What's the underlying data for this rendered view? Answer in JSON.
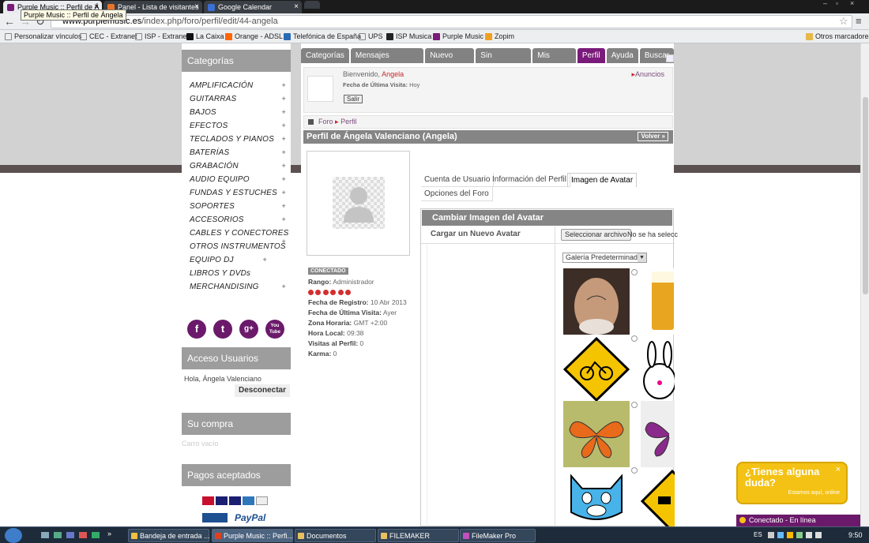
{
  "browser": {
    "tabs": [
      {
        "label": "Purple Music :: Perfil de Á",
        "color": "#7a1a7a"
      },
      {
        "label": "Panel - Lista de visitantes",
        "color": "#e8742a"
      },
      {
        "label": "Google Calendar",
        "color": "#3b6fd6"
      }
    ],
    "tooltip": "Purple Music :: Perfil de Ángela",
    "url_host": "www.purplemusic.es",
    "url_path": "/index.php/foro/perfil/edit/44-angela",
    "bookmarks": [
      "Personalizar vínculos",
      "CEC - Extranet",
      "ISP - Extranet",
      "La Caixa",
      "Orange - ADSL",
      "Telefónica de España",
      "UPS",
      "ISP Musica",
      "Purple Music",
      "Zopim"
    ],
    "other_bookmarks": "Otros marcadores"
  },
  "sidebar": {
    "categories_title": "Categorías",
    "categories": [
      "AMPLIFICACIÓN",
      "GUITARRAS",
      "BAJOS",
      "EFECTOS",
      "TECLADOS Y PIANOS",
      "BATERÍAS",
      "GRABACIÓN",
      "AUDIO EQUIPO",
      "FUNDAS Y ESTUCHES",
      "SOPORTES",
      "ACCESORIOS",
      "CABLES Y CONECTORES",
      "OTROS INSTRUMENTOS",
      "EQUIPO DJ",
      "LIBROS Y DVDs",
      "MERCHANDISING"
    ],
    "social": [
      "f",
      "t",
      "g+",
      "You Tube"
    ],
    "access_title": "Acceso Usuarios",
    "greeting": "Hola, Ángela Valenciano",
    "logout": "Desconectar",
    "cart_title": "Su compra",
    "cart_empty": "Carro vacío",
    "payments_title": "Pagos aceptados",
    "paypal": "PayPal"
  },
  "forum": {
    "menu": [
      "Categorías",
      "Mensajes Recientes",
      "Nuevo Tema",
      "Sin Respuesta",
      "Mis Temas",
      "Perfil",
      "Ayuda",
      "Buscar"
    ],
    "welcome": "Bienvenido,",
    "username": "Angela",
    "last_visit_label": "Fecha de Última Visita:",
    "last_visit_value": "Hoy",
    "logout_button": "Salir",
    "announcements": "Anuncios",
    "breadcrumb": [
      "Foro",
      "Perfil"
    ],
    "profile_title": "Perfil de Ángela Valenciano (Angela)",
    "back_button": "Volver »",
    "status_badge": "CONECTADO",
    "stats": [
      {
        "label": "Rango:",
        "value": "Administrador"
      },
      {
        "label": "Fecha de Registro:",
        "value": "10 Abr 2013"
      },
      {
        "label": "Fecha de Última Visita:",
        "value": "Ayer"
      },
      {
        "label": "Zona Horaria:",
        "value": "GMT +2:00"
      },
      {
        "label": "Hora Local:",
        "value": "09:38"
      },
      {
        "label": "Visitas al Perfil:",
        "value": "0"
      },
      {
        "label": "Karma:",
        "value": "0"
      }
    ],
    "profile_tabs": [
      "Cuenta de Usuario",
      "Información del Perfil",
      "Imagen de Avatar",
      "Opciones del Foro"
    ],
    "avatar_panel_title": "Cambiar Imagen del Avatar",
    "upload_label": "Cargar un Nuevo Avatar",
    "file_button": "Seleccionar archivo",
    "file_status": "No se ha selecc",
    "gallery_select": "Galería Predeterminada"
  },
  "chat": {
    "question": "¿Tienes alguna duda?",
    "status_line": "Estamos aquí, online",
    "bar": "Conectado - En línea"
  },
  "taskbar": {
    "items": [
      "Bandeja de entrada ...",
      "Purple Music :: Perfi...",
      "Documentos",
      "FILEMAKER",
      "FileMaker Pro"
    ],
    "lang": "ES",
    "clock": "9:50"
  }
}
